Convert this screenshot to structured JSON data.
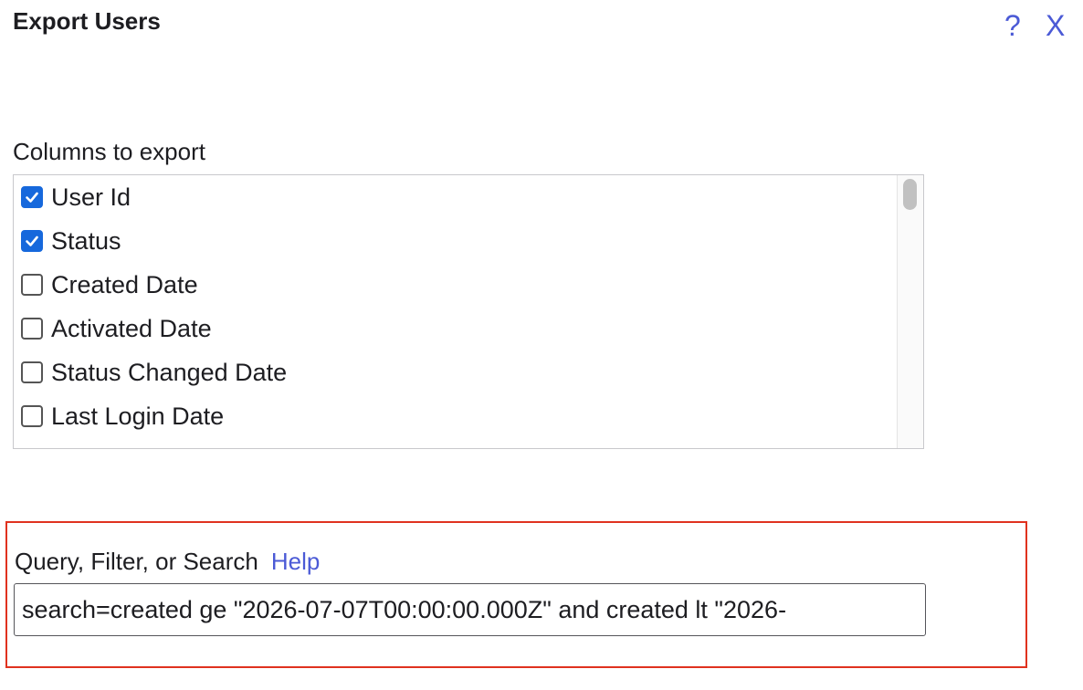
{
  "dialog": {
    "title": "Export Users",
    "help_icon": "?",
    "close_icon": "X"
  },
  "columns": {
    "label": "Columns to export",
    "items": [
      {
        "label": "User Id",
        "checked": true
      },
      {
        "label": "Status",
        "checked": true
      },
      {
        "label": "Created Date",
        "checked": false
      },
      {
        "label": "Activated Date",
        "checked": false
      },
      {
        "label": "Status Changed Date",
        "checked": false
      },
      {
        "label": "Last Login Date",
        "checked": false
      },
      {
        "label": "",
        "checked": false
      }
    ]
  },
  "query": {
    "label": "Query, Filter, or Search",
    "help_link": "Help",
    "value": "search=created ge \"2026-07-07T00:00:00.000Z\" and created lt \"2026-"
  },
  "colors": {
    "accent": "#4b5ad6",
    "checkbox_checked": "#1668dc",
    "highlight_border": "#e0321f"
  }
}
